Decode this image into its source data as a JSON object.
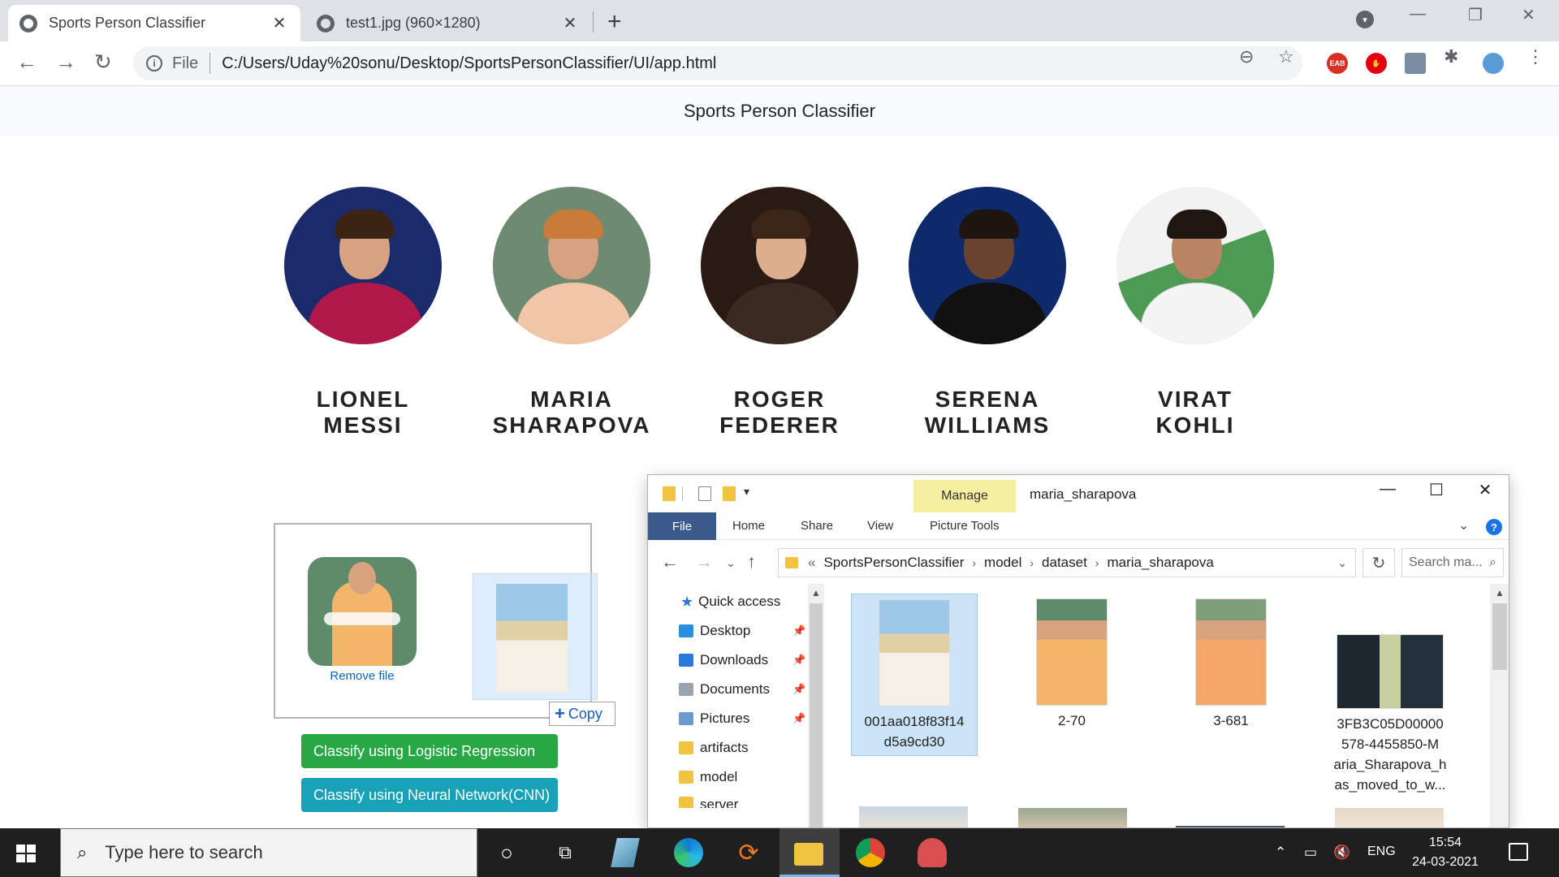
{
  "browser": {
    "tabs": [
      {
        "title": "Sports Person Classifier"
      },
      {
        "title": "test1.jpg (960×1280)"
      }
    ],
    "new_tab": "+",
    "close_glyph": "✕",
    "scheme": "File",
    "url": "C:/Users/Uday%20sonu/Desktop/SportsPersonClassifier/UI/app.html",
    "extensions": [
      {
        "name": "eab-extension-icon",
        "label": "EAB",
        "color": "#d93025"
      },
      {
        "name": "adblock-icon",
        "label": "",
        "color": "#e0000f"
      },
      {
        "name": "image-extension-icon",
        "label": "",
        "color": "#7a8ca0"
      }
    ]
  },
  "page": {
    "header_title": "Sports Person Classifier",
    "people": [
      {
        "name_line1": "LIONEL",
        "name_line2": "MESSI",
        "bg": "#1b2a6b",
        "shirt": "#b0184a",
        "hair": "#3b2414"
      },
      {
        "name_line1": "MARIA",
        "name_line2": "SHARAPOVA",
        "bg": "#6e8a70",
        "shirt": "#f0c6a6",
        "hair": "#c97b3a"
      },
      {
        "name_line1": "ROGER",
        "name_line2": "FEDERER",
        "bg": "#2a1a14",
        "shirt": "#3a2a22",
        "hair": "#3a2516"
      },
      {
        "name_line1": "SERENA",
        "name_line2": "WILLIAMS",
        "bg": "#0e2a6a",
        "shirt": "#111111",
        "hair": "#1e1410"
      },
      {
        "name_line1": "VIRAT KOHLI",
        "name_line2": "",
        "bg": "#4d9a54",
        "shirt": "#f4f4f4",
        "hair": "#1f1612"
      }
    ],
    "dropzone": {
      "remove_label": "Remove file",
      "copy_label": "Copy",
      "copy_glyph": "+"
    },
    "buttons": {
      "logistic": "Classify using Logistic Regression",
      "cnn": "Classify using Neural Network(CNN)"
    }
  },
  "explorer": {
    "manage_tab": "Manage",
    "title": "maria_sharapova",
    "ribbon_tabs": [
      "File",
      "Home",
      "Share",
      "View",
      "Picture Tools"
    ],
    "breadcrumb_prefix": "«",
    "breadcrumb": [
      "SportsPersonClassifier",
      "model",
      "dataset",
      "maria_sharapova"
    ],
    "search_placeholder": "Search ma...",
    "nav_items": [
      {
        "label": "Quick access",
        "color": "#2b78d8",
        "pinned": false
      },
      {
        "label": "Desktop",
        "color": "#2b8fe0",
        "pinned": true
      },
      {
        "label": "Downloads",
        "color": "#2b78d8",
        "pinned": true
      },
      {
        "label": "Documents",
        "color": "#9aa4ad",
        "pinned": true
      },
      {
        "label": "Pictures",
        "color": "#6a9ad0",
        "pinned": true
      },
      {
        "label": "artifacts",
        "color": "#f0c440",
        "pinned": false
      },
      {
        "label": "model",
        "color": "#f0c440",
        "pinned": false
      },
      {
        "label": "server",
        "color": "#f0c440",
        "pinned": false
      }
    ],
    "files": [
      {
        "name_lines": [
          "001aa018f83f14",
          "d5a9cd30"
        ],
        "selected": true
      },
      {
        "name_lines": [
          "2-70"
        ],
        "selected": false
      },
      {
        "name_lines": [
          "3-681"
        ],
        "selected": false
      },
      {
        "name_lines": [
          "3FB3C05D00000",
          "578-4455850-M",
          "aria_Sharapova_h",
          "as_moved_to_w..."
        ],
        "selected": false
      }
    ]
  },
  "taskbar": {
    "search_placeholder": "Type here to search",
    "language": "ENG",
    "time": "15:54",
    "date": "24-03-2021"
  }
}
